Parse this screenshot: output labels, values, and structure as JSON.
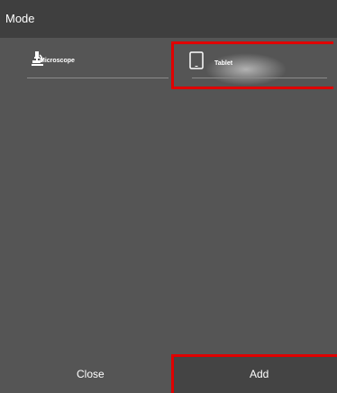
{
  "header": {
    "title": "Mode"
  },
  "modes": [
    {
      "label": "Microscope",
      "icon": "microscope-icon"
    },
    {
      "label": "Tablet",
      "icon": "tablet-icon",
      "selected": true
    }
  ],
  "footer": {
    "close_label": "Close",
    "add_label": "Add"
  },
  "colors": {
    "background": "#555555",
    "header": "#3f3f3f",
    "highlight": "#e00000",
    "text": "#ffffff"
  }
}
